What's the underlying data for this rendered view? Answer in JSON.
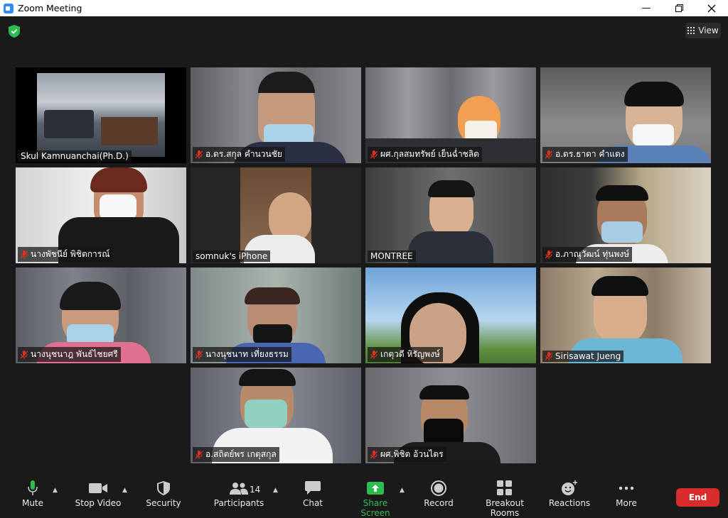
{
  "window": {
    "title": "Zoom Meeting"
  },
  "top": {
    "view_label": "View"
  },
  "participants": [
    {
      "name": "Skul Kamnuanchai(Ph.D.)",
      "muted": false,
      "active": true
    },
    {
      "name": "อ.ดร.สกุล  คำนวนชัย",
      "muted": true
    },
    {
      "name": "ผศ.กุลสมทรัพย์  เย็นฉ่ำชลิต",
      "muted": true
    },
    {
      "name": "อ.ดร.ธาดา  คำแดง",
      "muted": true
    },
    {
      "name": "นางพัชนีย์  พิชิตการณ์",
      "muted": true
    },
    {
      "name": "somnuk's iPhone",
      "muted": false
    },
    {
      "name": "MONTREE",
      "muted": false
    },
    {
      "name": "อ.ภาณุวัฒน์  ทุ่นพงษ์",
      "muted": true
    },
    {
      "name": "นางนุชนาฎ  พันธ์ไชยศรี",
      "muted": true
    },
    {
      "name": "นางนุชนาท  เที่ยงธรรม",
      "muted": true
    },
    {
      "name": "เกตุวดี หิรัญพงษ์",
      "muted": true
    },
    {
      "name": "Sirisawat Jueng",
      "muted": true
    },
    {
      "name": "อ.สถิตย์พร  เกตุสกุล",
      "muted": true
    },
    {
      "name": "ผศ.พิชิต  อ้วนไตร",
      "muted": true
    }
  ],
  "toolbar": {
    "mute": "Mute",
    "stop_video": "Stop Video",
    "security": "Security",
    "participants": "Participants",
    "participants_count": "14",
    "chat": "Chat",
    "share_screen": "Share Screen",
    "record": "Record",
    "breakout_rooms": "Breakout Rooms",
    "reactions": "Reactions",
    "more": "More",
    "end": "End"
  },
  "colors": {
    "active_border": "#c8e26f",
    "share_green": "#2dbc4e",
    "end_red": "#d92c2c",
    "accent_blue": "#2d8cff"
  }
}
